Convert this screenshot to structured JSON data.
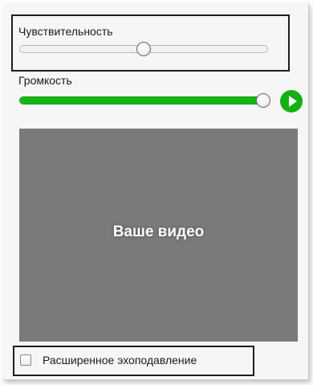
{
  "sensitivity": {
    "label": "Чувствительность",
    "value": 0.5
  },
  "volume": {
    "label": "Громкость",
    "value": 1.0,
    "play_icon": "play-icon"
  },
  "video": {
    "placeholder": "Ваше видео"
  },
  "echo_cancellation": {
    "label": "Расширенное эхоподавление",
    "checked": false
  },
  "colors": {
    "accent_green": "#15b515",
    "video_bg": "#7a7a7a",
    "panel_bg": "#f6f6f6"
  }
}
